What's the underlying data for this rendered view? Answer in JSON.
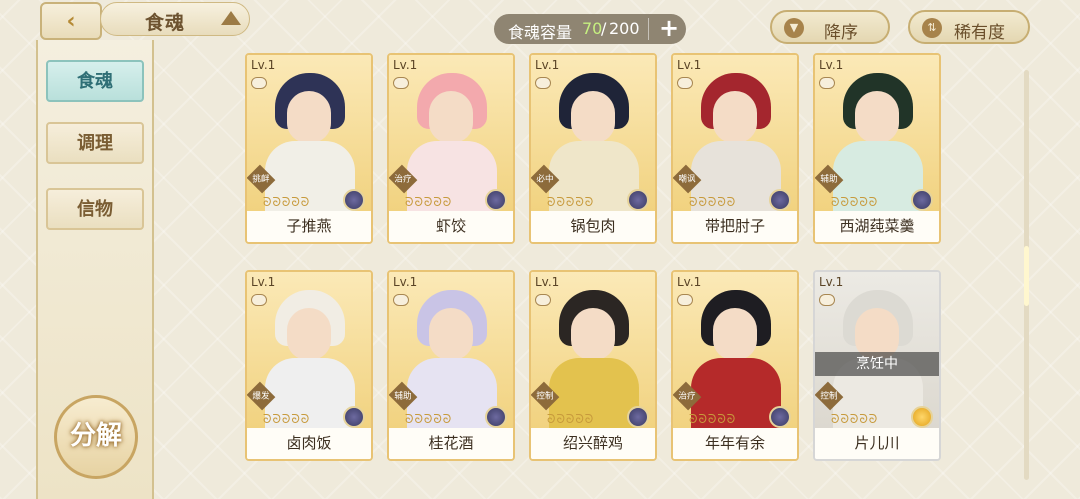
{
  "header": {
    "title": "食魂",
    "capacity_label": "食魂容量",
    "capacity_current": "70",
    "capacity_sep": "/",
    "capacity_max": "200",
    "add_label": "+",
    "sort_desc_label": "降序",
    "sort_rarity_label": "稀有度"
  },
  "sidebar": {
    "tabs": [
      {
        "label": "食魂",
        "active": true
      },
      {
        "label": "调理",
        "active": false
      },
      {
        "label": "信物",
        "active": false
      }
    ],
    "decompose_label": "分解"
  },
  "cards": [
    {
      "level": "Lv.1",
      "role": "挑衅",
      "name": "子推燕",
      "stars": "ᘐᘐᘐᘐᘐ",
      "hair": "#2e3356",
      "body": "#f1efe7",
      "gem": "purple"
    },
    {
      "level": "Lv.1",
      "role": "治疗",
      "name": "虾饺",
      "stars": "ᘐᘐᘐᘐᘐ",
      "hair": "#f3a9ad",
      "body": "#f7e3e3",
      "gem": "purple"
    },
    {
      "level": "Lv.1",
      "role": "必中",
      "name": "锅包肉",
      "stars": "ᘐᘐᘐᘐᘐ",
      "hair": "#1f2438",
      "body": "#efe6c9",
      "gem": "purple"
    },
    {
      "level": "Lv.1",
      "role": "嘲讽",
      "name": "带把肘子",
      "stars": "ᘐᘐᘐᘐᘐ",
      "hair": "#a4262e",
      "body": "#e7e2da",
      "gem": "purple"
    },
    {
      "level": "Lv.1",
      "role": "辅助",
      "name": "西湖莼菜羹",
      "stars": "ᘐᘐᘐᘐᘐ",
      "hair": "#213428",
      "body": "#d7ebe1",
      "gem": "purple"
    },
    {
      "level": "Lv.1",
      "role": "爆发",
      "name": "卤肉饭",
      "stars": "ᘐᘐᘐᘐᘐ",
      "hair": "#f1ede4",
      "body": "#efefef",
      "gem": "purple"
    },
    {
      "level": "Lv.1",
      "role": "辅助",
      "name": "桂花酒",
      "stars": "ᘐᘐᘐᘐᘐ",
      "hair": "#c9c4e6",
      "body": "#e6e3f2",
      "gem": "purple"
    },
    {
      "level": "Lv.1",
      "role": "控制",
      "name": "绍兴醉鸡",
      "stars": "ᘐᘐᘐᘐᘐ",
      "hair": "#2b2623",
      "body": "#e3c24e",
      "gem": "purple"
    },
    {
      "level": "Lv.1",
      "role": "治疗",
      "name": "年年有余",
      "stars": "ᘐᘐᘐᘐᘐ",
      "hair": "#1e1d22",
      "body": "#b52a2a",
      "gem": "purple"
    },
    {
      "level": "Lv.1",
      "role": "控制",
      "name": "片儿川",
      "stars": "ᘐᘐᘐᘐᘐ",
      "hair": "#dcdad3",
      "body": "#ece9e2",
      "gem": "gold",
      "status": "烹饪中"
    }
  ]
}
